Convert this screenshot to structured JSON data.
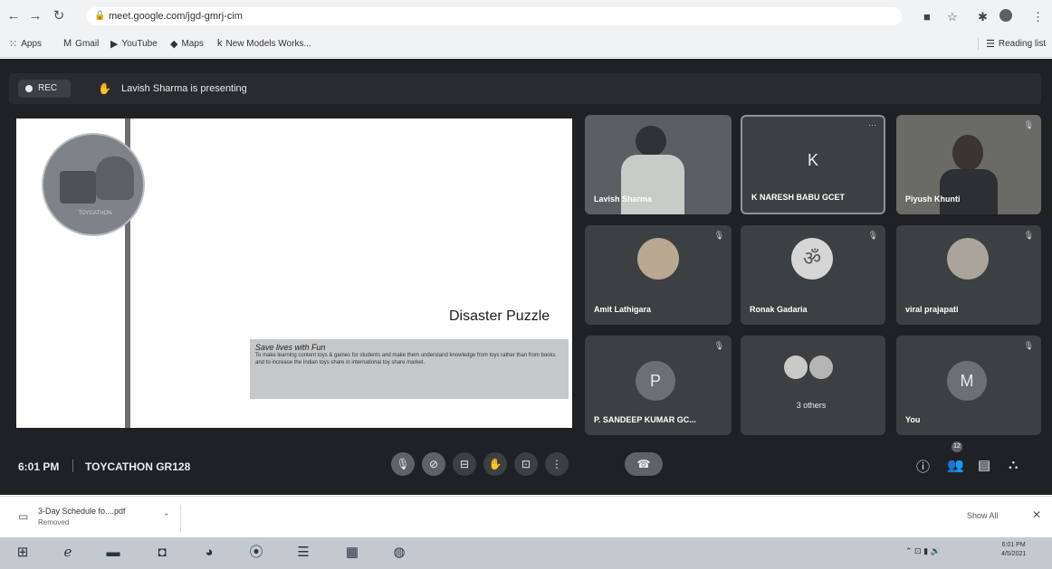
{
  "browser": {
    "url": "meet.google.com/jgd-gmrj-cim",
    "bookmarks": [
      "Apps",
      "Gmail",
      "YouTube",
      "Maps",
      "New Models Works..."
    ],
    "reading_list": "Reading list"
  },
  "meet": {
    "rec_label": "REC",
    "presenting_text": "Lavish Sharma is presenting",
    "slide": {
      "logo_text": "TOYCATHON",
      "title": "Disaster Puzzle",
      "subtitle": "Save lives with Fun",
      "body": "To make learning content toys & games for students and make them understand knowledge from toys rather than from books and to increase the Indian toys share in international toy share market."
    },
    "participants": [
      {
        "name": "Lavish Sharma",
        "kind": "video"
      },
      {
        "name": "K NARESH BABU GCET",
        "kind": "letter",
        "letter": "K"
      },
      {
        "name": "Piyush Khunti",
        "kind": "video"
      },
      {
        "name": "Amit Lathigara",
        "kind": "photo"
      },
      {
        "name": "Ronak Gadaria",
        "kind": "photo"
      },
      {
        "name": "viral prajapati",
        "kind": "photo"
      },
      {
        "name": "P. SANDEEP KUMAR GC...",
        "kind": "letter",
        "letter": "P"
      },
      {
        "name": "3 others",
        "kind": "group"
      },
      {
        "name": "You",
        "kind": "letter",
        "letter": "M"
      }
    ],
    "time": "6:01 PM",
    "meeting_name": "TOYCATHON GR128",
    "people_count": "12",
    "colors": {
      "background": "#202124",
      "tile": "#3c4043",
      "letter_avatar": "#6d6f73"
    }
  },
  "downloads": {
    "file_name": "3-Day Schedule fo....pdf",
    "status": "Removed",
    "show_all": "Show All"
  },
  "taskbar": {
    "clock_time": "6:01 PM",
    "clock_date": "4/5/2021"
  }
}
